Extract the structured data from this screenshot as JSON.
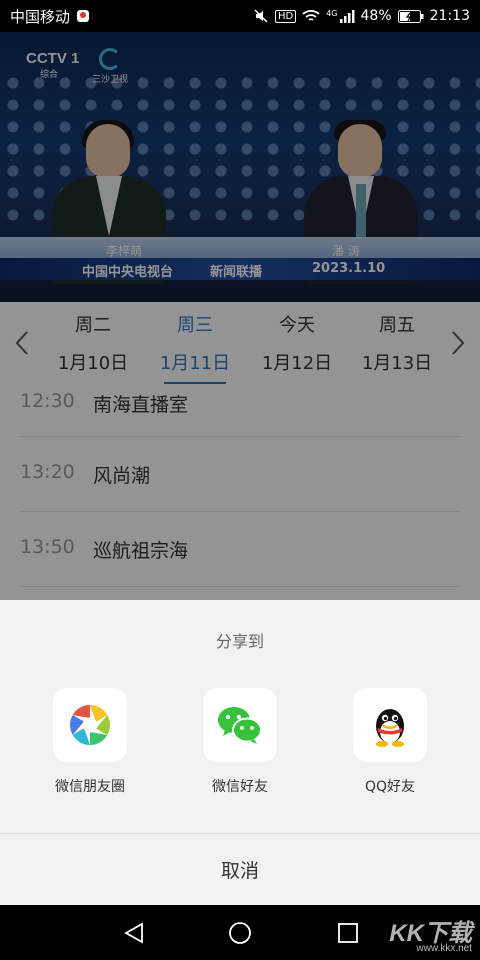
{
  "status_bar": {
    "carrier": "中国移动",
    "hd": "HD",
    "network": "4G",
    "battery": "48%",
    "time": "21:13"
  },
  "video": {
    "channel_logo": "CCTV 1",
    "channel_sub": "综合",
    "partner_logo": "三沙卫视",
    "anchor_left_name": "李梓萌",
    "anchor_right_name": "潘  涛",
    "caption_left": "中国中央电视台",
    "caption_center": "新闻联播",
    "caption_right": "2023.1.10"
  },
  "date_tabs": [
    {
      "weekday": "周二",
      "date": "1月10日",
      "active": false
    },
    {
      "weekday": "周三",
      "date": "1月11日",
      "active": true
    },
    {
      "weekday": "今天",
      "date": "1月12日",
      "active": false
    },
    {
      "weekday": "周五",
      "date": "1月13日",
      "active": false
    }
  ],
  "programs": [
    {
      "time": "12:30",
      "title": "南海直播室"
    },
    {
      "time": "13:20",
      "title": "风尚潮"
    },
    {
      "time": "13:50",
      "title": "巡航祖宗海"
    }
  ],
  "share": {
    "title": "分享到",
    "targets": [
      {
        "label": "微信朋友圈",
        "icon": "moments-icon"
      },
      {
        "label": "微信好友",
        "icon": "wechat-icon"
      },
      {
        "label": "QQ好友",
        "icon": "qq-icon"
      }
    ],
    "cancel": "取消"
  },
  "nav": {
    "back": "back-icon",
    "home": "home-icon",
    "recents": "recents-icon"
  },
  "watermark": {
    "logo": "KK下载",
    "url": "www.kkx.net"
  },
  "colors": {
    "accent": "#2e77c7",
    "sheet_bg": "#f2f2f2",
    "wechat_green": "#36c23a"
  }
}
